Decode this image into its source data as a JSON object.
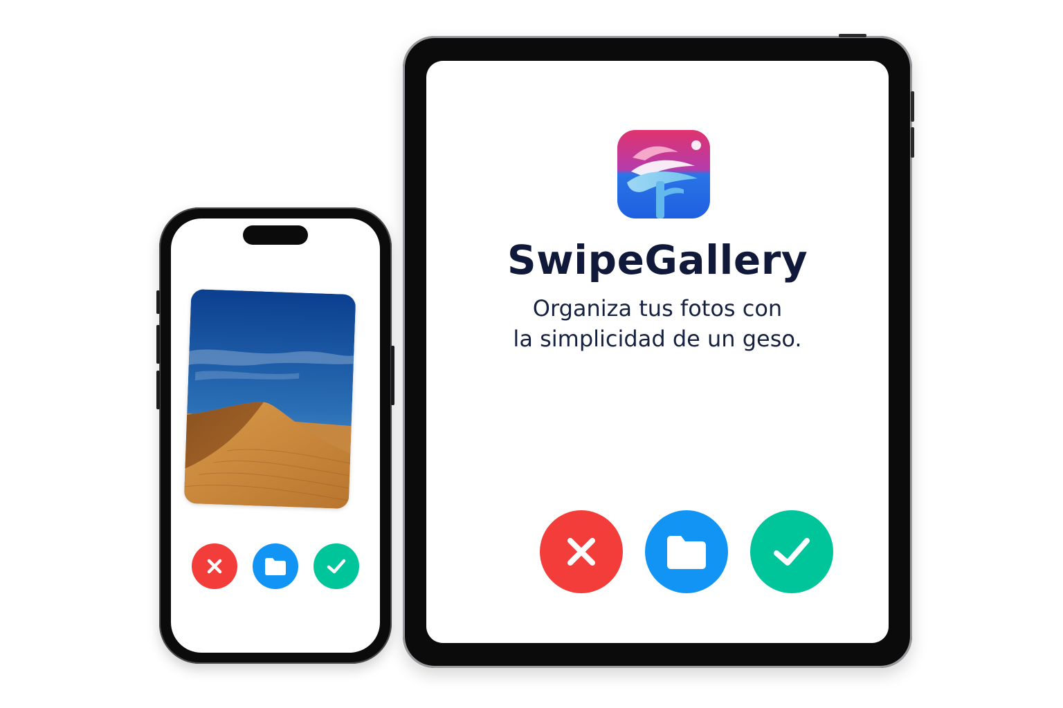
{
  "app": {
    "name": "SwipeGallery",
    "tagline_line1": "Organiza tus fotos con",
    "tagline_line2": "la simplicidad de un geso."
  },
  "actions": [
    {
      "id": "discard",
      "icon": "close-icon",
      "color": "#f23d3a"
    },
    {
      "id": "move_to_folder",
      "icon": "folder-icon",
      "color": "#1294f5"
    },
    {
      "id": "keep",
      "icon": "check-icon",
      "color": "#00c49a"
    }
  ],
  "colors": {
    "title": "#10193a",
    "icon_gradient_top": "#e0336e",
    "icon_gradient_bottom": "#1f5fe0"
  }
}
